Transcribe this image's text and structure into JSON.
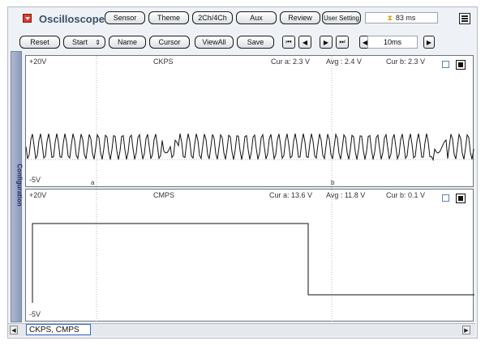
{
  "app": {
    "title": "Oscilloscope",
    "elapsed": "83 ms"
  },
  "toolbar": {
    "sensor": "Sensor",
    "theme": "Theme",
    "channels": "2Ch/4Ch",
    "aux": "Aux",
    "review": "Review",
    "user_setting": "User Setting"
  },
  "controls": {
    "reset": "Reset",
    "start": "Start",
    "name": "Name",
    "cursor": "Cursor",
    "viewall": "ViewAll",
    "save": "Save",
    "time_scale": "10ms"
  },
  "sidebar": {
    "label": "Configuration"
  },
  "channels": [
    {
      "name": "CKPS",
      "ymax": "+20V",
      "ymin": "-5V",
      "cur_a": "Cur a: 2.3 V",
      "avg": "Avg   : 2.4 V",
      "cur_b": "Cur b: 2.3 V",
      "cursor_a": "a",
      "cursor_b": "b"
    },
    {
      "name": "CMPS",
      "ymax": "+20V",
      "ymin": "-5V",
      "cur_a": "Cur a: 13.6 V",
      "avg": "Avg   : 11.8 V",
      "cur_b": "Cur b: 0.1 V"
    }
  ],
  "statusbar": {
    "active_channels": "CKPS, CMPS"
  },
  "colors": {
    "accent": "#3b4f6b",
    "logo": "#d93a2b",
    "trace": "#111111"
  },
  "icons": [
    "logo-icon",
    "hourglass-icon",
    "menu-icon",
    "first-icon",
    "prev-icon",
    "next-icon",
    "last-icon",
    "scale-left-icon",
    "scale-right-icon"
  ]
}
